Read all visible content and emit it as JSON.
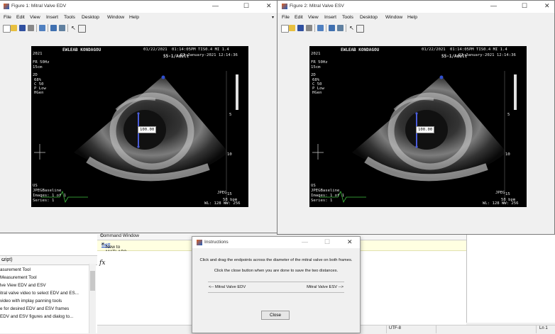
{
  "figure1": {
    "title": "Figure 1: Mitral Valve EDV",
    "measurement_label": "100.00"
  },
  "figure2": {
    "title": "Figure 2: Mitral Valve ESV",
    "measurement_label": "100.00"
  },
  "menu": [
    "File",
    "Edit",
    "View",
    "Insert",
    "Tools",
    "Desktop",
    "Window",
    "Help"
  ],
  "echo": {
    "hospital": "EWLEAB KONDAGOU",
    "year": "2021",
    "date": "01/22/2021",
    "time": "01:14:05PM",
    "tis": "TIS0.4 MI 1.4",
    "probe": "S5-1/Adult",
    "date_long": "22-January-2021 12:14:36",
    "fr": "FR 50Hz",
    "depth": "15cm",
    "mode_2d": "2D",
    "params": [
      "68%",
      "C 50",
      "P Low",
      "HGen"
    ],
    "scale": [
      "5",
      "10",
      "15"
    ],
    "jpeg": "JPEG",
    "bpm": "58 bpm",
    "footer_lines": [
      "US",
      "JPEGBaseline",
      "Images: 1 of 1",
      "Series: 1"
    ],
    "wl": "WL: 128 WW: 256"
  },
  "command_window": {
    "title": "Command Window",
    "banner_prefix": "New to MATLAB? See resources for",
    "banner_link": "Gett",
    "prompt": "fx"
  },
  "left_panel": {
    "header": "cript)",
    "items": [
      "asurement Tool",
      "Measurement Tool",
      "lve View EDV and ESV",
      "itral valve video to select EDV and ES...",
      "video with implay panning tools",
      "e for desired EDV and ESV frames",
      "EDV and ESV figures and  dialog to..."
    ]
  },
  "status": {
    "encoding": "UTF-8",
    "position": "Ln 1"
  },
  "dialog": {
    "title": "Instructions",
    "message1": "Click and drag the endpoints across the diameter of the mitral valve on both frames.",
    "message2": "Click the close button when you are done to save the two distances.",
    "left_label": "<-- Mitral Valve EDV",
    "right_label": "Mitral Valve ESV -->",
    "close_label": "Close"
  }
}
